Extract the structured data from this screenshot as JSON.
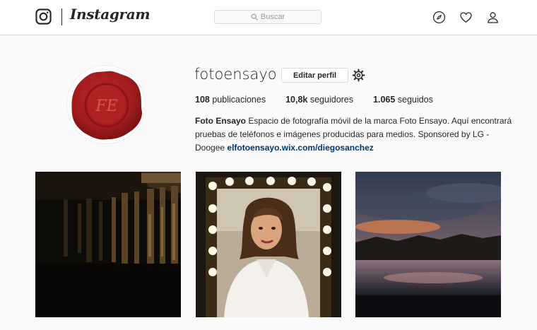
{
  "nav": {
    "wordmark": "Instagram",
    "search_placeholder": "Buscar",
    "icons": [
      "instagram-glyph-icon",
      "search-icon",
      "compass-icon",
      "heart-icon",
      "profile-icon"
    ]
  },
  "profile": {
    "username": "fotoensayo",
    "edit_label": "Editar perfil",
    "stats": [
      {
        "value": "108",
        "label": "publicaciones"
      },
      {
        "value": "10,8k",
        "label": "seguidores"
      },
      {
        "value": "1.065",
        "label": "seguidos"
      }
    ],
    "bio_name": "Foto Ensayo",
    "bio_text": "Espacio de fotografía móvil de la marca Foto Ensayo. Aquí encontrará pruebas de teléfonos e imágenes producidas para medios. Sponsored by LG - Doogee",
    "bio_link": "elfotoensayo.wix.com/diegosanchez",
    "avatar": "wax-seal-logo"
  },
  "posts": [
    {
      "subject": "dark-wooden-fence-shadows"
    },
    {
      "subject": "woman-portrait-mirror-lights"
    },
    {
      "subject": "sunset-clouds-mountains"
    }
  ],
  "colors": {
    "background": "#fafafa",
    "border": "#dbdbdb",
    "text": "#262626",
    "link": "#003569",
    "seal": "#a11d1d"
  }
}
